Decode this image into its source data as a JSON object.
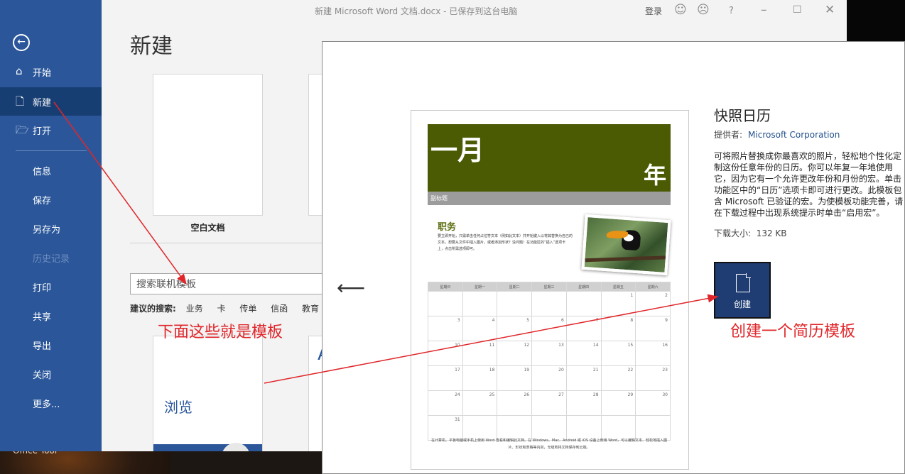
{
  "desktop": {
    "caption": "Office Tool"
  },
  "titlebar": {
    "doc_title": "新建 Microsoft Word 文档.docx - 已保存到这台电脑",
    "login": "登录",
    "help": "?"
  },
  "sidebar": {
    "items": [
      {
        "label": "开始",
        "icon": "home-icon"
      },
      {
        "label": "新建",
        "icon": "new-doc-icon"
      },
      {
        "label": "打开",
        "icon": "folder-open-icon"
      },
      {
        "label": "信息"
      },
      {
        "label": "保存"
      },
      {
        "label": "另存为"
      },
      {
        "label": "历史记录"
      },
      {
        "label": "打印"
      },
      {
        "label": "共享"
      },
      {
        "label": "导出"
      },
      {
        "label": "关闭"
      },
      {
        "label": "更多..."
      }
    ]
  },
  "main": {
    "heading": "新建",
    "blank_label": "空白文档",
    "search_placeholder": "搜索联机模板",
    "suggest_lead": "建议的搜索:",
    "suggestions": [
      "业务",
      "卡",
      "传单",
      "信函",
      "教育"
    ],
    "browse_label": "浏览",
    "second_template_glyph": "A"
  },
  "preview": {
    "title": "快照日历",
    "provider_label": "提供者:",
    "provider": "Microsoft Corporation",
    "description": "可将照片替换成你最喜欢的照片，轻松地个性化定制这份任意年份的日历。你可以年复一年地使用它，因为它有一个允许更改年份和月份的宏。单击功能区中的“日历”选项卡即可进行更改。此模板包含 Microsoft 已验证的宏。为使模板功能完善，请在下载过程中出现系统提示时单击“启用宏”。",
    "size_label": "下载大小:",
    "size": "132 KB",
    "create_label": "创建",
    "calendar": {
      "month": "一月",
      "year": "年",
      "subtitle": "副标题",
      "task_title": "职务",
      "task_desc": "要立即开始，只需单击任何占位符文本（例如此文本）并开始键入以将其替换为自己的文本。想要从文件中插入图片，或者添加形状？没问题！在功能区的“插入”选项卡上，点击所需选项即可。",
      "weekdays": [
        "星期日",
        "星期一",
        "星期二",
        "星期三",
        "星期四",
        "星期五",
        "星期六"
      ],
      "weeks": [
        [
          "",
          "",
          "",
          "",
          "",
          "1",
          "2"
        ],
        [
          "3",
          "4",
          "5",
          "6",
          "7",
          "8",
          "9"
        ],
        [
          "10",
          "11",
          "12",
          "13",
          "14",
          "15",
          "16"
        ],
        [
          "17",
          "18",
          "19",
          "20",
          "21",
          "22",
          "23"
        ],
        [
          "24",
          "25",
          "26",
          "27",
          "28",
          "29",
          "30"
        ],
        [
          "31",
          "",
          "",
          "",
          "",
          "",
          ""
        ]
      ],
      "footer": "在计算机、平板电脑或手机上使用 Word 查看和编辑此文档。在 Windows、Mac、Android 或 iOS 设备上使用 Word，可以编辑文本、轻松地插入图片、形状和表格等内容，无缝地将文档保存到云端。"
    }
  },
  "annotations": {
    "templates_note": "下面这些就是模板",
    "create_note": "创建一个简历模板",
    "color": "#e0262a"
  }
}
